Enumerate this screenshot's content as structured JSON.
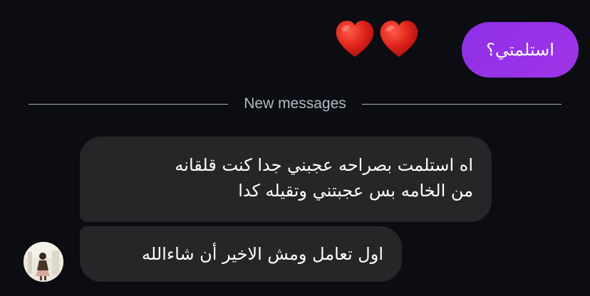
{
  "thread": {
    "sent_message": {
      "text": "استلمتي؟"
    },
    "reaction": {
      "icons": [
        "red-heart-icon",
        "red-heart-icon"
      ],
      "color": "#e0241b"
    },
    "divider": {
      "label": "New messages"
    },
    "received_messages": [
      {
        "lines": [
          "اه استلمت بصراحه عجبني جدا كنت قلقانه",
          "من الخامه بس عجبتني وتقيله كدا"
        ]
      },
      {
        "lines": [
          "اول تعامل ومش الاخير أن شاءالله"
        ]
      }
    ],
    "sender_avatar": {
      "icon": "avatar-photo"
    }
  },
  "colors": {
    "background": "#0b0d12",
    "sent_bubble": "#9433e7",
    "received_bubble": "#262628",
    "divider_text": "#b3b8c2"
  }
}
